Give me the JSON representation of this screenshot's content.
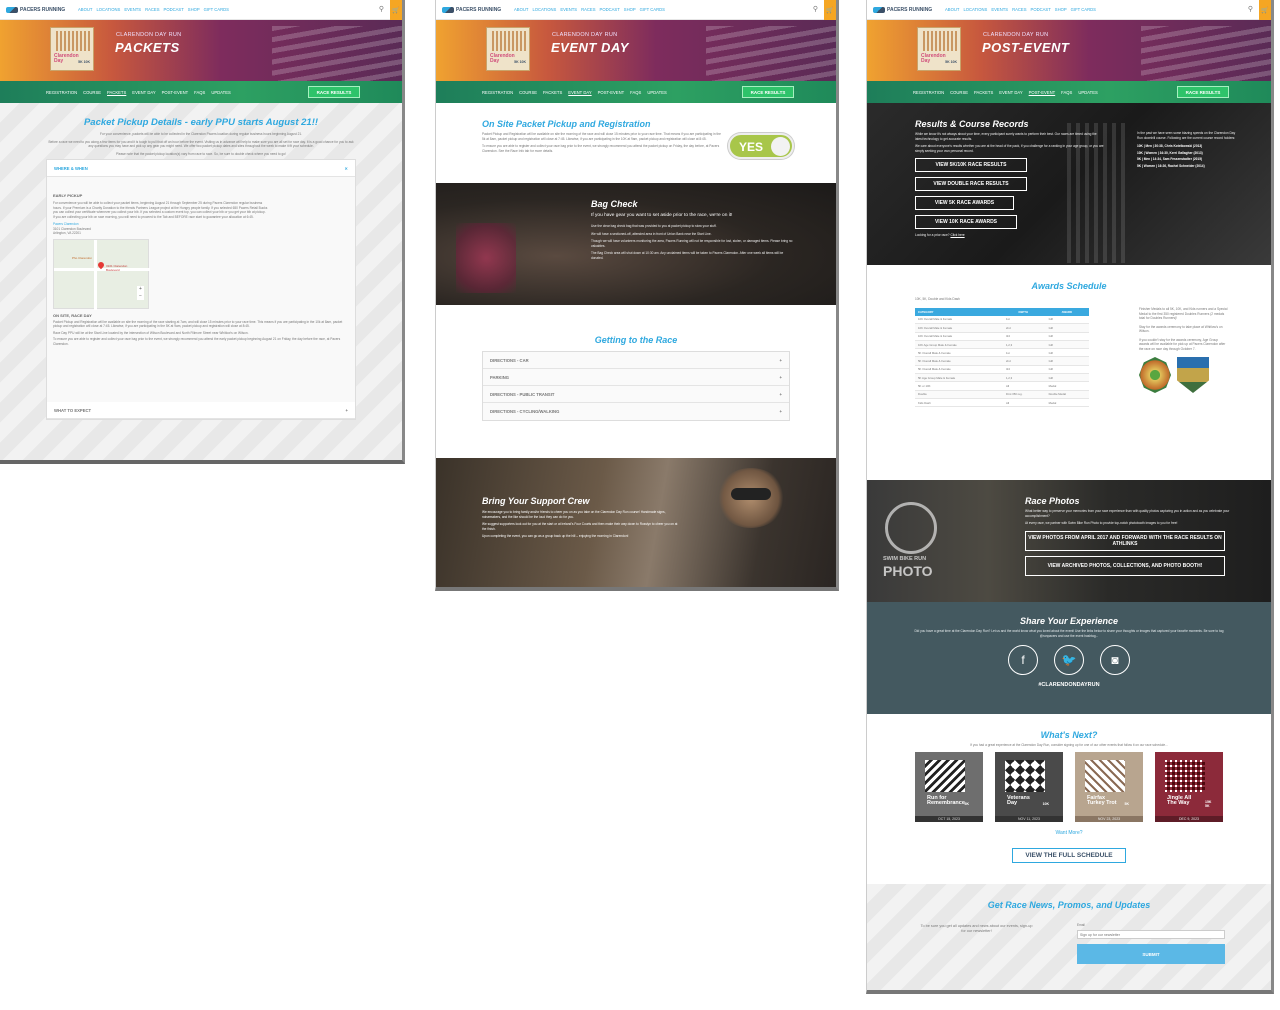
{
  "site": {
    "brand": "PACERS RUNNING",
    "nav": [
      "ABOUT",
      "LOCATIONS",
      "EVENTS",
      "RACES",
      "PODCAST",
      "SHOP",
      "GIFT CARDS"
    ],
    "hero_subtitle": "CLARENDON DAY RUN",
    "badge_title": "Clarendon Day",
    "badge_sub": "5K 10K",
    "race_results": "RACE RESULTS",
    "subnav": [
      "REGISTRATION",
      "COURSE",
      "PACKETS",
      "EVENT DAY",
      "POST-EVENT",
      "FAQS",
      "UPDATES"
    ]
  },
  "packets": {
    "hero_title": "PACKETS",
    "heading": "Packet Pickup Details - early PPU starts August 21!!",
    "intro": "For your convenience, packets will be able to be collected in the Clarendon Pacers location during regular business hours beginning August 21.",
    "intro2": "Before a race we need to you along a few items for you and it is tough to pull that off an hour before the event. Visiting us in advance will help to make sure you are all set for race day. It is a good chance for you to ask any questions you may have and pick up any gear you might need. We offer two packet pickup dates and sites throughout the week to make it fit your schedule.",
    "intro3": "Please note that the packet pickup location(s) vary from race to race. So, be sure to double check where you need to go!",
    "where_when": "WHERE & WHEN",
    "close": "✕",
    "early_pickup": "EARLY PICKUP",
    "early_text": "For convenience you will be able to collect your packet items, beginning August 21 through September 25 during Pacers Clarendon regular business hours. If your Premium is a Charity Donation to the friends Partners League project at the Hungry people family. If you selected 650 Pacers Retail Bucks you can collect your certificate whenever you collect your bib. If you selected a custom event top, you can collect your bib or you get your bib at pickup. If you are collecting your bib on race morning, you will need to proceed to the Tab and BEFORE race start to guarantee your allocation at 6:45.",
    "address_name": "Pacers Clarendon",
    "address_street": "3101 Clarendon Boulevard",
    "address_city": "Arlington, VA 22201",
    "map_label1": "Pho Clarendon",
    "map_label2": "3101 Clarendon Boulevard",
    "onsite_heading": "ON SITE, RACE DAY",
    "onsite_text": "Packet Pickup and Registration will be available on site the morning of the race starting at 7am, and will close 15 minutes prior to your race time. This means if you are participating in the 10k at 8am, packet pickup and registration will close at 7:45. Likewise, if you are participating in the 5K at 9am, packet pickup and registration will close at 8:45.",
    "onsite_text2": "Race Day PPU will be at the Start Line located by the intersection of Wilson Boulevard and North Fillmore Street near Whitlow's on Wilson.",
    "onsite_text3": "To ensure you are able to register and collect your race bag prior to the event, we strongly recommend you attend the early packet pickup beginning August 21 on Friday, the day before the race, at Pacers Clarendon.",
    "what_to_expect": "WHAT TO EXPECT"
  },
  "eventday": {
    "hero_title": "EVENT DAY",
    "onsite_heading": "On Site Packet Pickup and Registration",
    "onsite_text": "Packet Pickup and Registration will be available on site the morning of the race and will close 15 minutes prior to your race time. That means if you are participating in the 5k at 8am, packet pickup and registration will close at 7:45. Likewise, if you are participating in the 10K at 9am, packet pickup and registration will close at 8:45.",
    "onsite_text2": "To ensure you are able to register and collect your race bag prior to the event, we strongly recommend you attend the packet pickup on Friday, the day before, at Pacers Clarendon. See the Race Info tab for more details.",
    "yes": "YES",
    "bag_heading": "Bag Check",
    "bag_lead": "If you have gear you want to set aside prior to the race, we're on it!",
    "bag_p1": "Use the clear bag check bag that was provided to you at packet pickup to stow your stuff.",
    "bag_p2": "We will have a sectioned-off, attended area in front of Union Bank near the Start Line.",
    "bag_p3": "Though we will have volunteers monitoring the area, Pacers Running will not be responsible for lost, stolen, or damaged items. Please bring no valuables.",
    "bag_p4": "The Bag Check area will shut down at 10:30 am. Any unclaimed items will be taken to Pacers Clarendon. After one week all items will be donated.",
    "getting_heading": "Getting to the Race",
    "directions": [
      "DIRECTIONS - CAR",
      "PARKING",
      "DIRECTIONS - PUBLIC TRANSIT",
      "DIRECTIONS - CYCLING/WALKING"
    ],
    "crew_heading": "Bring Your Support Crew",
    "crew_p1": "We encourage you to bring family and/or friends to cheer you on as you take on the Clarendon Day Run course! Handmade signs, noisemakers, and the like should be the loud they can do for you.",
    "crew_p2": "We suggest supporters look out for you at the start or at Ireland's Four Courts and then make their way down to Rosslyn to cheer you on at the finish.",
    "crew_p3": "Upon completing the event, you can go as a group back up the hill – enjoying the morning in Clarendon!"
  },
  "postevent": {
    "hero_title": "POST-EVENT",
    "results_heading": "Results & Course Records",
    "results_p1": "While we know it's not always about your time, every participant surely wants to perform their best. Our races are timed using the latest technology to get accurate results.",
    "results_p2": "We care about everyone's results whether you are at the head of the pack, if you challenge for a ranking in your age group, or you are simply seeking your own personal record.",
    "results_buttons": [
      "VIEW 5K/10K RACE RESULTS",
      "VIEW DOUBLE RACE RESULTS",
      "VIEW 5K RACE AWARDS",
      "VIEW 10K RACE AWARDS"
    ],
    "looking": "Looking for a prior race?",
    "click_here": "Click here",
    "records_intro": "In the past we have seen some blazing speeds on the Clarendon Day Run downhill course. Following are the current course record holders:",
    "records": [
      "10K | Men | 30:38, Chris Kotelkowski (2013)",
      "10K | Women | 34:30, Kerri Gallagher (2013)",
      "5K | Men | 14:34, Sam Fessenstadter (2015)",
      "5K | Women | 16:26, Rachel Schneider (2014)"
    ],
    "awards_heading": "Awards Schedule",
    "awards_sub": "10K, 5K, Double and Kids Dash",
    "awards_cols": [
      "CATEGORY",
      "DEPTH",
      "AWARD"
    ],
    "awards_rows": [
      [
        "10K Overall Male & Female",
        "1st",
        "Gift"
      ],
      [
        "10K Overall Male & Female",
        "2nd",
        "Gift"
      ],
      [
        "10K Overall Male & Female",
        "3rd",
        "Gift"
      ],
      [
        "10K Age Group Male & Female",
        "1,2,3",
        "Gift"
      ],
      [
        "5K Overall Male & Female",
        "1st",
        "Gift"
      ],
      [
        "5K Overall Male & Female",
        "2nd",
        "Gift"
      ],
      [
        "5K Overall Male & Female",
        "3rd",
        "Gift"
      ],
      [
        "5K Age Group Male & Female",
        "1,2,3",
        "Gift"
      ],
      [
        "5K or 10K",
        "All",
        "Medal"
      ],
      [
        "Double",
        "First 350 reg.",
        "Double Medal"
      ],
      [
        "Kids Dash",
        "All",
        "Medal"
      ]
    ],
    "awards_note1": "Finisher Medals to all 5K, 10K, and Kids runners and a Special Medal to the first 350 registered Doubles Runners (2 medals total for Doubles Runners)!",
    "awards_note2": "Stay for the awards ceremony to take place at Whitlow's on Wilson.",
    "awards_note3": "If you couldn't stay for the awards ceremony, Age Group awards will be available for pick up at Pacers Clarendon after the race on race day through October 7.",
    "photos_heading": "Race Photos",
    "photos_p1": "What better way to preserve your memories from your race experience than with quality photos capturing you in action and as you celebrate your accomplishment?",
    "photos_p2": "At every race, we partner with Swim Bike Run Photo to provide top-notch photobooth images to you for free!",
    "photos_btn1": "VIEW PHOTOS FROM APRIL 2017 AND FORWARD WITH THE RACE RESULTS ON ATHLINKS",
    "photos_btn2": "VIEW ARCHIVED PHOTOS, COLLECTIONS, AND PHOTO BOOTH!",
    "photo_logo1": "SWIM BIKE RUN",
    "photo_logo2": "PHOTO",
    "share_heading": "Share Your Experience",
    "share_p": "Did you have a great time at the Clarendon Day Run? Let us and the world know what you loved about the event! Use the links below to share your thoughts or images that captured your favorite moments. Be sure to tag @runpacers and use the event hashtag...",
    "hashtag": "#CLARENDONDAYRUN",
    "next_heading": "What's Next?",
    "next_sub": "If you had a great experience at the Clarendon Day Run, consider signing up for one of our other events that follow it on our race schedule...",
    "next_events": [
      {
        "name": "Run for Remembrance",
        "dist": "5K",
        "date": "OCT 15, 2023",
        "color": "#ffffff"
      },
      {
        "name": "Veterans Day",
        "dist": "10K",
        "date": "NOV 11, 2023",
        "color": "#ffffff"
      },
      {
        "name": "Fairfax Turkey Trot",
        "dist": "5K",
        "date": "NOV 23, 2023",
        "color": "#ffffff"
      },
      {
        "name": "Jingle All The Way",
        "dist": "15K 5K",
        "date": "DEC 9, 2023",
        "color": "#ffffff"
      }
    ],
    "want_more": "Want More?",
    "full_schedule": "VIEW THE FULL SCHEDULE",
    "news_heading": "Get Race News, Promos, and Updates",
    "news_p": "To be sure you get all updates and news about our events, sign-up for our newsletter!",
    "email_label": "Email",
    "email_placeholder": "Sign up for our newsletter",
    "submit": "SUBMIT"
  }
}
